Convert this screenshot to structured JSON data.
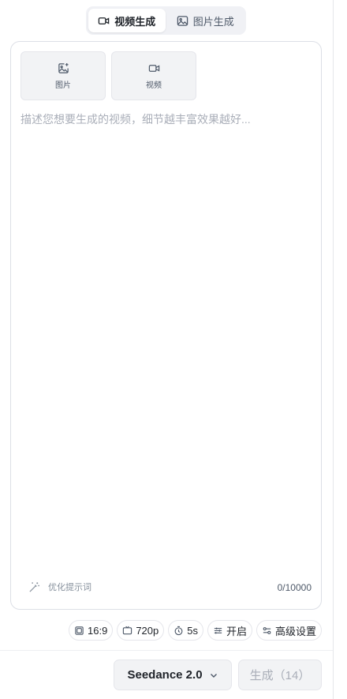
{
  "mode_tabs": [
    {
      "label": "视频生成",
      "icon": "video-camera-icon",
      "active": true
    },
    {
      "label": "图片生成",
      "icon": "image-icon",
      "active": false
    }
  ],
  "uploads": [
    {
      "label": "图片",
      "icon": "image-plus-icon"
    },
    {
      "label": "视频",
      "icon": "video-camera-icon"
    }
  ],
  "prompt": {
    "value": "",
    "placeholder": "描述您想要生成的视频，细节越丰富效果越好..."
  },
  "optimize_label": "优化提示词",
  "char_count": "0/10000",
  "settings": {
    "ratio": "16:9",
    "resolution": "720p",
    "duration": "5s",
    "toggle": "开启",
    "advanced": "高级设置"
  },
  "model": {
    "selected": "Seedance 2.0"
  },
  "generate_label": "生成（14）",
  "colors": {
    "border": "#dcdfe6",
    "muted": "#a9aeb8",
    "tile_bg": "#f2f3f5"
  }
}
